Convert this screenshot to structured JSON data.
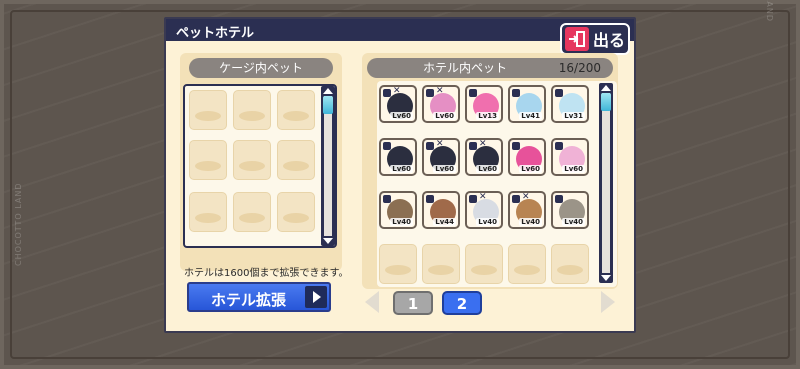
{
  "background": {
    "brand": "CHOCOTTO LAND"
  },
  "window": {
    "title": "ペットホテル",
    "exit_label": "出る"
  },
  "cage_panel": {
    "header": "ケージ内ペット"
  },
  "hotel_panel": {
    "header": "ホテル内ペット",
    "count": "16/200",
    "pets": [
      {
        "level": "Lv60",
        "color": "#2b2e3f",
        "locked": true,
        "marked": true
      },
      {
        "level": "Lv60",
        "color": "#e58fc4",
        "locked": true,
        "marked": true
      },
      {
        "level": "Lv13",
        "color": "#f06fae",
        "locked": true,
        "marked": false
      },
      {
        "level": "Lv41",
        "color": "#a8d6ee",
        "locked": true,
        "marked": false
      },
      {
        "level": "Lv31",
        "color": "#bfe3f2",
        "locked": true,
        "marked": false
      },
      {
        "level": "Lv60",
        "color": "#2b2e3f",
        "locked": true,
        "marked": false
      },
      {
        "level": "Lv60",
        "color": "#2b2e3f",
        "locked": true,
        "marked": true
      },
      {
        "level": "Lv60",
        "color": "#2b2e3f",
        "locked": true,
        "marked": true
      },
      {
        "level": "Lv60",
        "color": "#e7529a",
        "locked": true,
        "marked": false
      },
      {
        "level": "Lv60",
        "color": "#f0b2d6",
        "locked": true,
        "marked": false
      },
      {
        "level": "Lv40",
        "color": "#8b6f52",
        "locked": true,
        "marked": false
      },
      {
        "level": "Lv44",
        "color": "#a06a4a",
        "locked": true,
        "marked": false
      },
      {
        "level": "Lv40",
        "color": "#d8dce3",
        "locked": true,
        "marked": true
      },
      {
        "level": "Lv40",
        "color": "#b88452",
        "locked": true,
        "marked": true
      },
      {
        "level": "Lv40",
        "color": "#9b9488",
        "locked": true,
        "marked": false
      }
    ]
  },
  "footer": {
    "info": "ホテルは1600個まで拡張できます。",
    "expand_label": "ホテル拡張",
    "pages": [
      "1",
      "2"
    ],
    "active_page": "2"
  }
}
